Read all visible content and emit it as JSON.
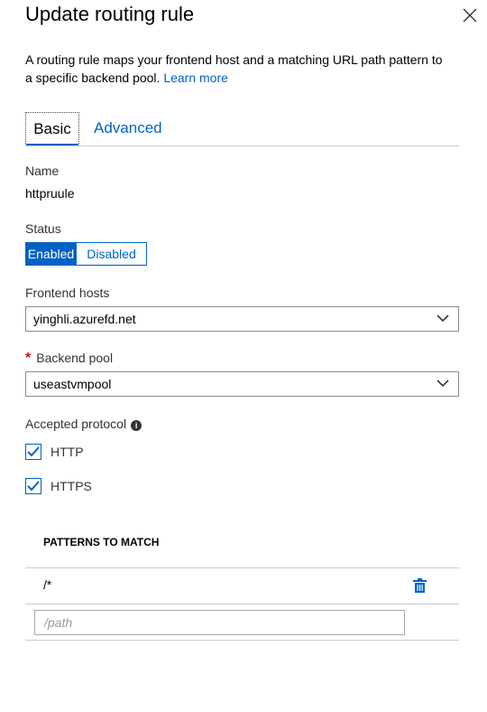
{
  "panel": {
    "title": "Update routing rule",
    "close_icon": "close-icon"
  },
  "description": {
    "text": "A routing rule maps your frontend host and a matching URL path pattern to a specific backend pool. ",
    "link": "Learn more"
  },
  "tabs": {
    "basic": "Basic",
    "advanced": "Advanced",
    "active": "Basic"
  },
  "name": {
    "label": "Name",
    "value": "httpruule"
  },
  "status": {
    "label": "Status",
    "enabled": "Enabled",
    "disabled": "Disabled",
    "selected": "Enabled"
  },
  "frontend_hosts": {
    "label": "Frontend hosts",
    "value": "yinghli.azurefd.net"
  },
  "backend_pool": {
    "required_marker": "*",
    "label": "Backend pool",
    "value": "useastvmpool"
  },
  "accepted_protocol": {
    "label": "Accepted protocol",
    "info_icon": "info-icon",
    "options": [
      {
        "label": "HTTP",
        "checked": true
      },
      {
        "label": "HTTPS",
        "checked": true
      }
    ]
  },
  "patterns": {
    "header": "PATTERNS TO MATCH",
    "rows": [
      {
        "value": "/*",
        "icon": "trash-icon"
      }
    ],
    "new_placeholder": "/path"
  },
  "colors": {
    "accent": "#0062c4",
    "required": "#e00b1c",
    "border": "#cccccc"
  }
}
